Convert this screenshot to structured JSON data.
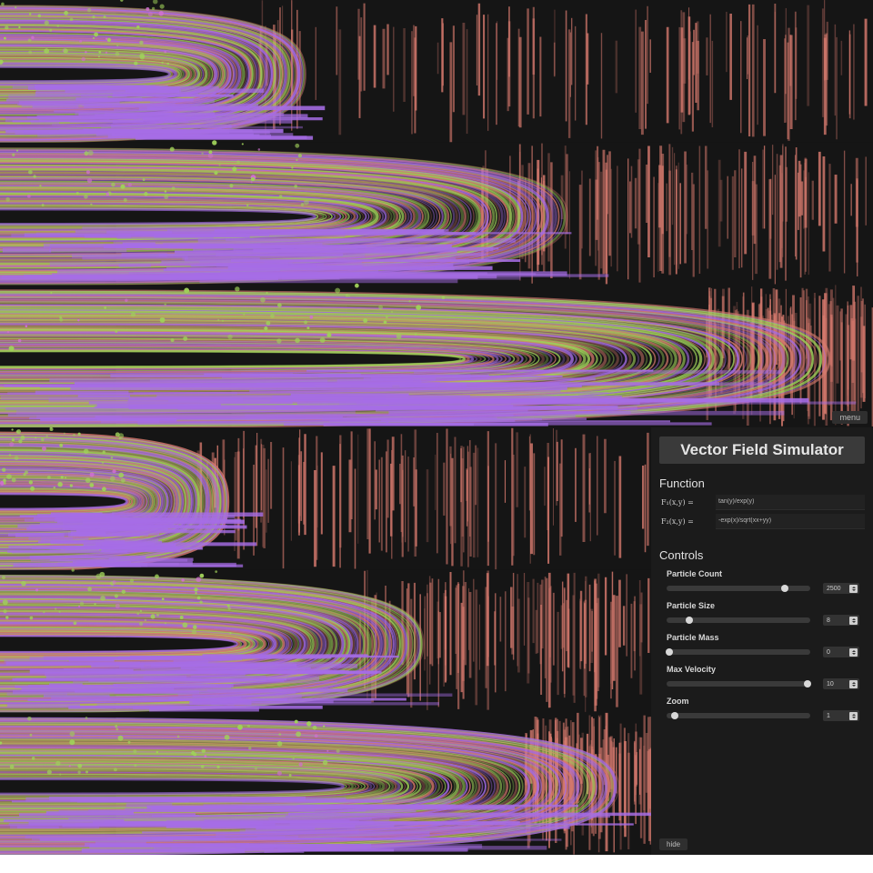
{
  "app": {
    "title": "Vector Field Simulator",
    "menu_label": "menu",
    "hide_label": "hide"
  },
  "function": {
    "section_title": "Function",
    "f1_label": "F₁(x,y) =",
    "f1_value": "tan(y)/exp(y)",
    "f2_label": "F₂(x,y) =",
    "f2_value": "-exp(x)/sqrt(xx+yy)"
  },
  "controls": {
    "section_title": "Controls",
    "items": [
      {
        "label": "Particle Count",
        "value": "2500",
        "fraction": 0.82
      },
      {
        "label": "Particle Size",
        "value": "8",
        "fraction": 0.16
      },
      {
        "label": "Particle Mass",
        "value": "0",
        "fraction": 0.02
      },
      {
        "label": "Max Velocity",
        "value": "10",
        "fraction": 0.98
      },
      {
        "label": "Zoom",
        "value": "1",
        "fraction": 0.06
      }
    ]
  },
  "colors": {
    "background": "#161616",
    "green": "#9fd05a",
    "purple": "#a66de6",
    "salmon": "#d77a6e",
    "panel": "#1b1b1b"
  }
}
